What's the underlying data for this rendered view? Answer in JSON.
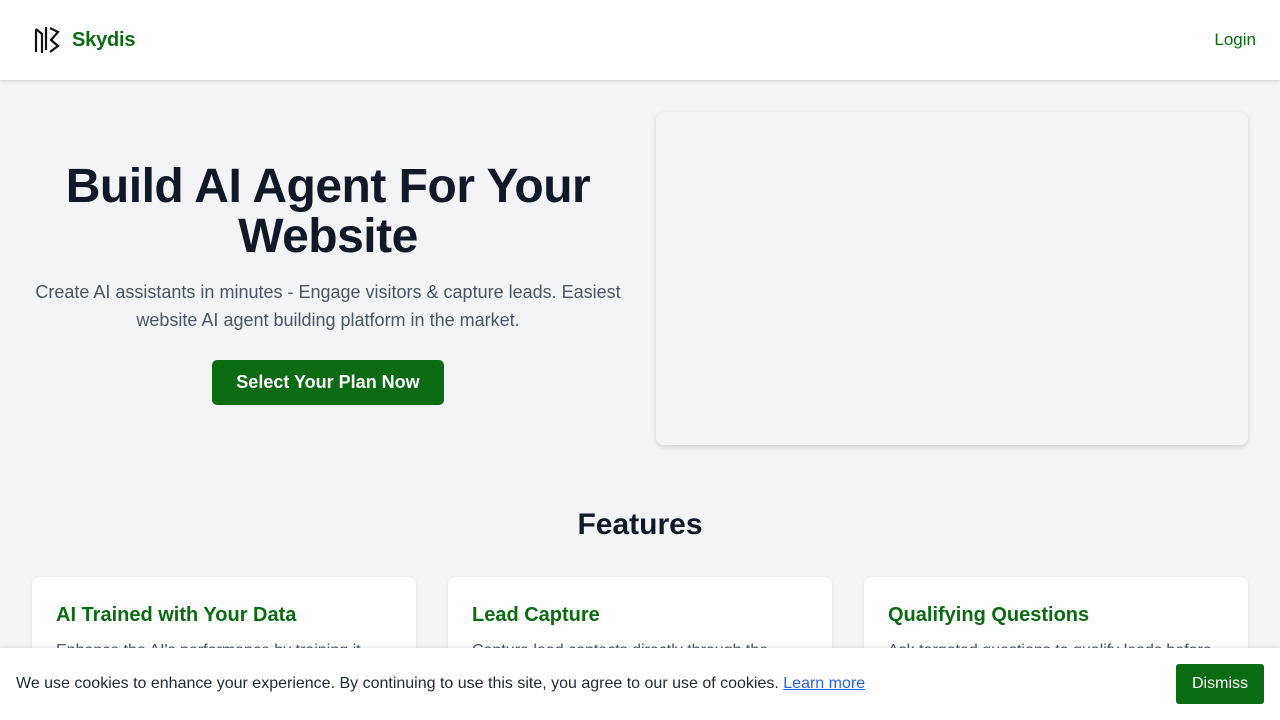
{
  "header": {
    "brand_name": "Skydis",
    "logo_icon": "skydis-logo-icon",
    "login_label": "Login",
    "accent_color": "#0b6b12"
  },
  "hero": {
    "title": "Build AI Agent For Your Website",
    "subtitle": "Create AI assistants in minutes - Engage visitors & capture leads. Easiest website AI agent building platform in the market.",
    "cta_label": "Select Your Plan Now"
  },
  "features": {
    "heading": "Features",
    "items": [
      {
        "title": "AI Trained with Your Data",
        "description": "Enhance the AI's performance by training it"
      },
      {
        "title": "Lead Capture",
        "description": "Capture lead contacts directly through the"
      },
      {
        "title": "Qualifying Questions",
        "description": "Ask targeted questions to qualify leads before"
      }
    ]
  },
  "cookie": {
    "message": "We use cookies to enhance your experience. By continuing to use this site, you agree to our use of cookies.",
    "link_label": "Learn more",
    "dismiss_label": "Dismiss"
  }
}
